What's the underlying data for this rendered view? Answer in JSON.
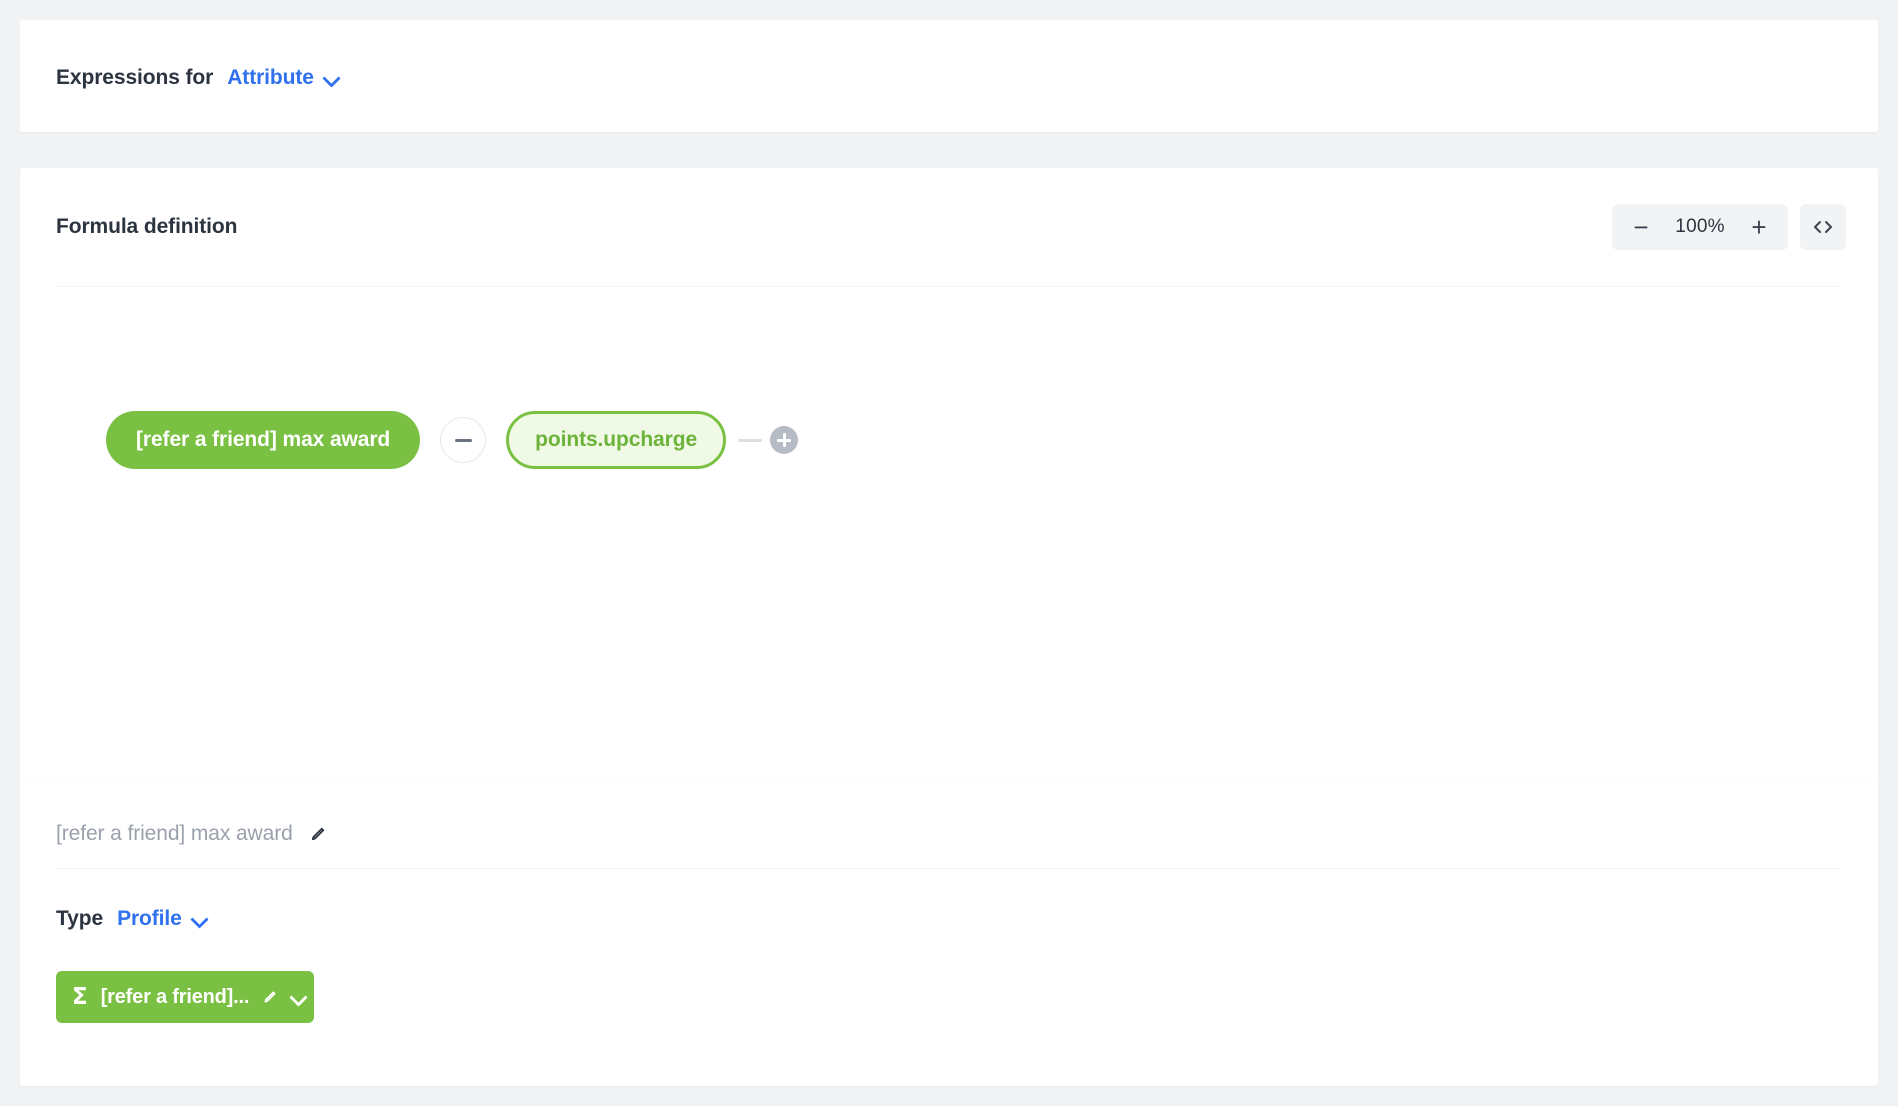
{
  "header": {
    "label": "Expressions for",
    "selector_value": "Attribute",
    "selector_icon": "chevron-down-icon"
  },
  "formula_card": {
    "title": "Formula definition",
    "toolbar": {
      "zoom_out_label": "−",
      "zoom_value": "100%",
      "zoom_in_label": "+",
      "code_view_icon": "code-brackets-icon"
    },
    "canvas": {
      "nodes": [
        {
          "label": "[refer a friend] max award",
          "style": "solid",
          "color": "#7ac143"
        },
        {
          "label": "points.upcharge",
          "style": "outline",
          "color": "#7ac143"
        }
      ],
      "operator": {
        "symbol": "−",
        "name": "subtract"
      },
      "add_button_icon": "plus-icon"
    }
  },
  "detail_panel": {
    "name_value": "[refer a friend] max award",
    "name_edit_icon": "pencil-icon",
    "type_label": "Type",
    "type_value": "Profile",
    "type_icon": "chevron-down-icon",
    "sum_chip": {
      "icon": "sigma-icon",
      "glyph": "Σ",
      "label": "[refer a friend]...",
      "edit_icon": "pencil-icon",
      "expand_icon": "chevron-down-icon"
    }
  },
  "colors": {
    "brand_green": "#7ac143",
    "green_soft_bg": "#f0f9e6",
    "link_blue": "#2f71ee",
    "text_dark": "#2c3440",
    "page_bg": "#f1f3f5"
  }
}
